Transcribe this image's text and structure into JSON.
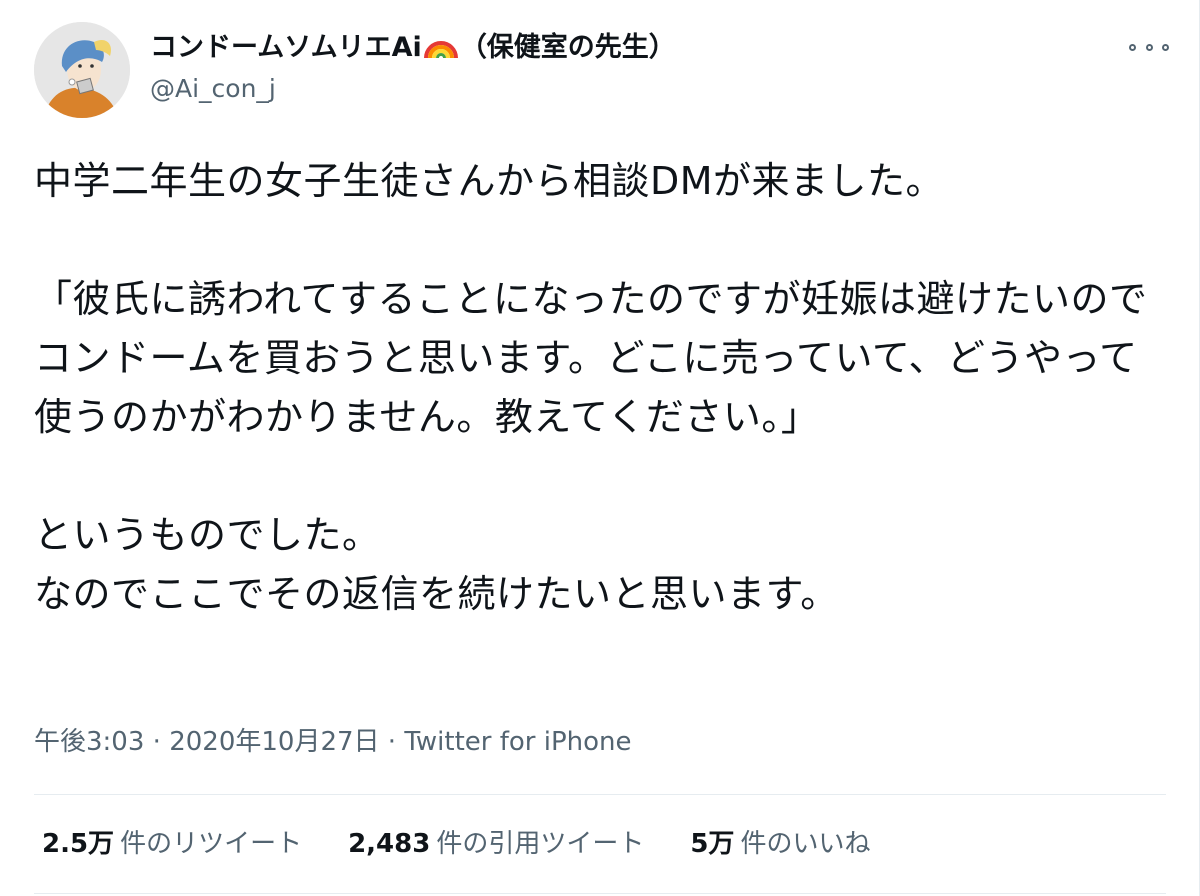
{
  "user": {
    "display_name_prefix": "コンドームソムリエAi",
    "display_name_suffix": "（保健室の先生）",
    "rainbow_icon": "rainbow-emoji",
    "handle": "@Ai_con_j"
  },
  "tweet": {
    "text": "中学二年生の女子生徒さんから相談DMが来ました。\n\n「彼氏に誘われてすることになったのですが妊娠は避けたいのでコンドームを買おうと思います。どこに売っていて、どうやって使うのかがわかりません。教えてください。」\n\nというものでした。\nなのでここでその返信を続けたいと思います。"
  },
  "meta": {
    "time": "午後3:03",
    "sep1": " · ",
    "date": "2020年10月27日",
    "sep2": " · ",
    "source": "Twitter for iPhone"
  },
  "stats": {
    "retweets_count": "2.5万",
    "retweets_label": "件のリツイート",
    "quotes_count": "2,483",
    "quotes_label": "件の引用ツイート",
    "likes_count": "5万",
    "likes_label": "件のいいね"
  },
  "colors": {
    "text": "#0f1419",
    "secondary": "#536471",
    "divider": "#e6ecf0"
  }
}
